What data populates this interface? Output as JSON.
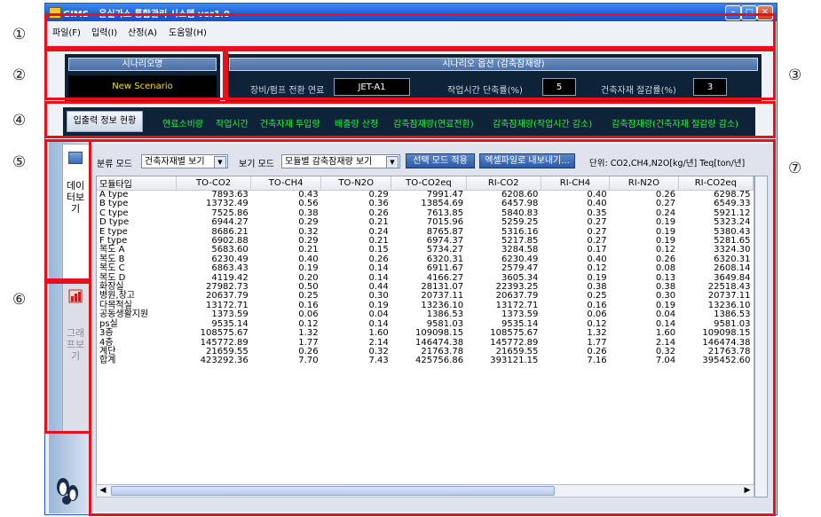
{
  "window": {
    "title": "GIMS - 온실가스 통합관리 시스템 ver1.0"
  },
  "menu": [
    "파일(F)",
    "입력(I)",
    "산정(A)",
    "도움말(H)"
  ],
  "scenario": {
    "header": "시나리오명",
    "name": "New Scenario"
  },
  "options": {
    "header": "시나리오 옵션 (감축잠재량)",
    "fuel_label": "장비/펌프 전환 연료",
    "fuel_value": "JET-A1",
    "time_label": "작업시간 단축률(%)",
    "time_value": "5",
    "material_label": "건축자재 절감률(%)",
    "material_value": "3"
  },
  "tabs": {
    "active": "입출력 정보 현황",
    "items": [
      "연료소비량",
      "작업시간",
      "건축자재 투입량",
      "배출량 산정",
      "감축잠재량(연료전환)",
      "감축잠재량(작업시간 감소)",
      "감축잠재량(건축자재 절감량 감소)"
    ]
  },
  "side": {
    "data_tab": "데이터보기",
    "graph_tab": "그래프보기"
  },
  "toolbar": {
    "category_label": "분류 모드",
    "category_value": "건축자재별 보기",
    "view_label": "보기 모드",
    "view_value": "모듈별 감축잠재량 보기",
    "apply_button": "선택 모드 적용",
    "export_button": "엑셀파일로 내보내기...",
    "unit_text": "단위: CO2,CH4,N2O[kg/년]  Teq[ton/년]"
  },
  "table": {
    "columns": [
      "모듈타입",
      "TO-CO2",
      "TO-CH4",
      "TO-N2O",
      "TO-CO2eq",
      "RI-CO2",
      "RI-CH4",
      "RI-N2O",
      "RI-CO2eq"
    ],
    "rows": [
      [
        "A type",
        "7893.63",
        "0.43",
        "0.29",
        "7991.47",
        "6208.60",
        "0.40",
        "0.26",
        "6298.75"
      ],
      [
        "B type",
        "13732.49",
        "0.56",
        "0.36",
        "13854.69",
        "6457.98",
        "0.40",
        "0.27",
        "6549.33"
      ],
      [
        "C type",
        "7525.86",
        "0.38",
        "0.26",
        "7613.85",
        "5840.83",
        "0.35",
        "0.24",
        "5921.12"
      ],
      [
        "D type",
        "6944.27",
        "0.29",
        "0.21",
        "7015.96",
        "5259.25",
        "0.27",
        "0.19",
        "5323.24"
      ],
      [
        "E type",
        "8686.21",
        "0.32",
        "0.24",
        "8765.87",
        "5316.16",
        "0.27",
        "0.19",
        "5380.43"
      ],
      [
        "F type",
        "6902.88",
        "0.29",
        "0.21",
        "6974.37",
        "5217.85",
        "0.27",
        "0.19",
        "5281.65"
      ],
      [
        "복도 A",
        "5683.60",
        "0.21",
        "0.15",
        "5734.27",
        "3284.58",
        "0.17",
        "0.12",
        "3324.30"
      ],
      [
        "복도 B",
        "6230.49",
        "0.40",
        "0.26",
        "6320.31",
        "6230.49",
        "0.40",
        "0.26",
        "6320.31"
      ],
      [
        "복도 C",
        "6863.43",
        "0.19",
        "0.14",
        "6911.67",
        "2579.47",
        "0.12",
        "0.08",
        "2608.14"
      ],
      [
        "복도 D",
        "4119.42",
        "0.20",
        "0.14",
        "4166.27",
        "3605.34",
        "0.19",
        "0.13",
        "3649.84"
      ],
      [
        "화장실",
        "27982.73",
        "0.50",
        "0.44",
        "28131.07",
        "22393.25",
        "0.38",
        "0.38",
        "22518.43"
      ],
      [
        "병원,창고",
        "20637.79",
        "0.25",
        "0.30",
        "20737.11",
        "20637.79",
        "0.25",
        "0.30",
        "20737.11"
      ],
      [
        "다목적실",
        "13172.71",
        "0.16",
        "0.19",
        "13236.10",
        "13172.71",
        "0.16",
        "0.19",
        "13236.10"
      ],
      [
        "공동생활지원",
        "1373.59",
        "0.06",
        "0.04",
        "1386.53",
        "1373.59",
        "0.06",
        "0.04",
        "1386.53"
      ],
      [
        "ps실",
        "9535.14",
        "0.12",
        "0.14",
        "9581.03",
        "9535.14",
        "0.12",
        "0.14",
        "9581.03"
      ],
      [
        "3층",
        "108575.67",
        "1.32",
        "1.60",
        "109098.15",
        "108575.67",
        "1.32",
        "1.60",
        "109098.15"
      ],
      [
        "4층",
        "145772.89",
        "1.77",
        "2.14",
        "146474.38",
        "145772.89",
        "1.77",
        "2.14",
        "146474.38"
      ],
      [
        "계단",
        "21659.55",
        "0.26",
        "0.32",
        "21763.78",
        "21659.55",
        "0.26",
        "0.32",
        "21763.78"
      ],
      [
        "합계",
        "423292.36",
        "7.70",
        "7.43",
        "425756.86",
        "393121.15",
        "7.16",
        "7.04",
        "395452.60"
      ]
    ]
  },
  "callouts": [
    "①",
    "②",
    "③",
    "④",
    "⑤",
    "⑥",
    "⑦"
  ],
  "colors": {
    "highlight": "#e8101a",
    "tab_text": "#21f23a",
    "dark_panel": "#0f2338"
  }
}
